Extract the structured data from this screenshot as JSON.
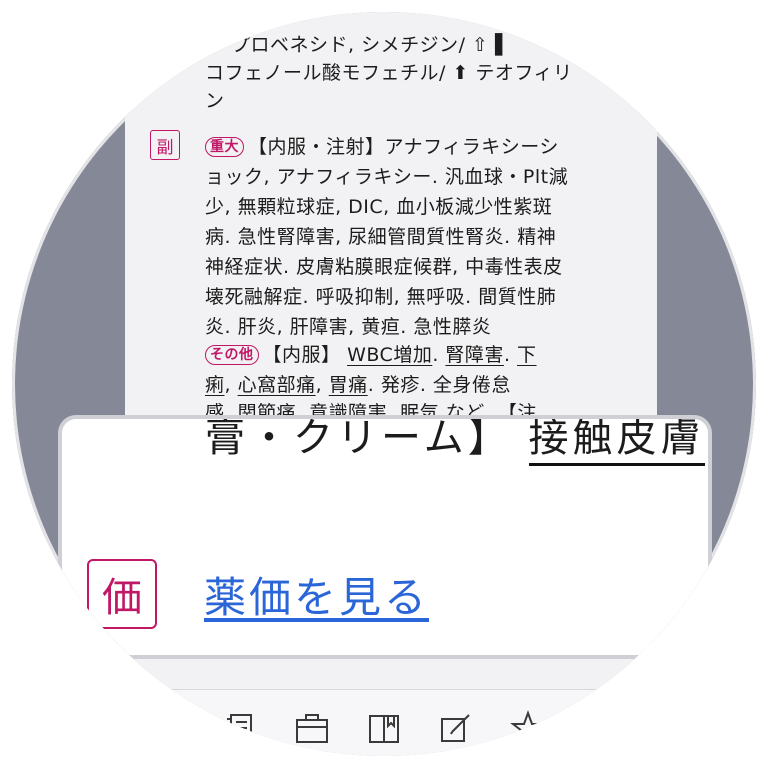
{
  "content": {
    "lines_top": [
      "〕 プロベネシド, シメチジン/ ⇧ ▌",
      "コフェノール酸モフェチル/ ⬆ テオフィリ",
      "ン"
    ],
    "side_effects_icon": "副",
    "severe_tag": "重大",
    "severe_lines": [
      "【内服・注射】アナフィラキシーシ",
      "ョック, アナフィラキシー. 汎血球・Plt減",
      "少, 無顆粒球症, DIC, 血小板減少性紫斑",
      "病. 急性腎障害, 尿細管間質性腎炎. 精神",
      "神経症状. 皮膚粘膜眼症候群, 中毒性表皮",
      "壊死融解症. 呼吸抑制, 無呼吸. 間質性肺",
      "炎. 肝炎, 肝障害, 黄疸. 急性膵炎"
    ],
    "other_tag": "その他",
    "other_line1": {
      "prefix": "【内服】",
      "a": "WBC増加",
      "sep1": ".",
      "b": "腎障害",
      "sep2": ".",
      "c": "下"
    },
    "other_line2": {
      "a": "痢",
      "sep1": ",",
      "b": "心窩部痛",
      "sep2": ",",
      "c": "胃痛",
      "rest": ". 発疹. 全身倦怠"
    },
    "other_line3": "感. 関節痛. 意識障害. 眠気 など. 【注"
  },
  "popup": {
    "partial_text_a": "膏・クリーム】",
    "partial_text_b": "接触皮膚",
    "price_icon": "価",
    "price_link": "薬価を見る"
  },
  "toolbar": {
    "icons": [
      "list-icon",
      "briefcase-icon",
      "book-icon",
      "edit-icon",
      "star-icon"
    ]
  },
  "colors": {
    "accent": "#c01866",
    "link": "#2b66d9",
    "backdrop": "#858896"
  }
}
